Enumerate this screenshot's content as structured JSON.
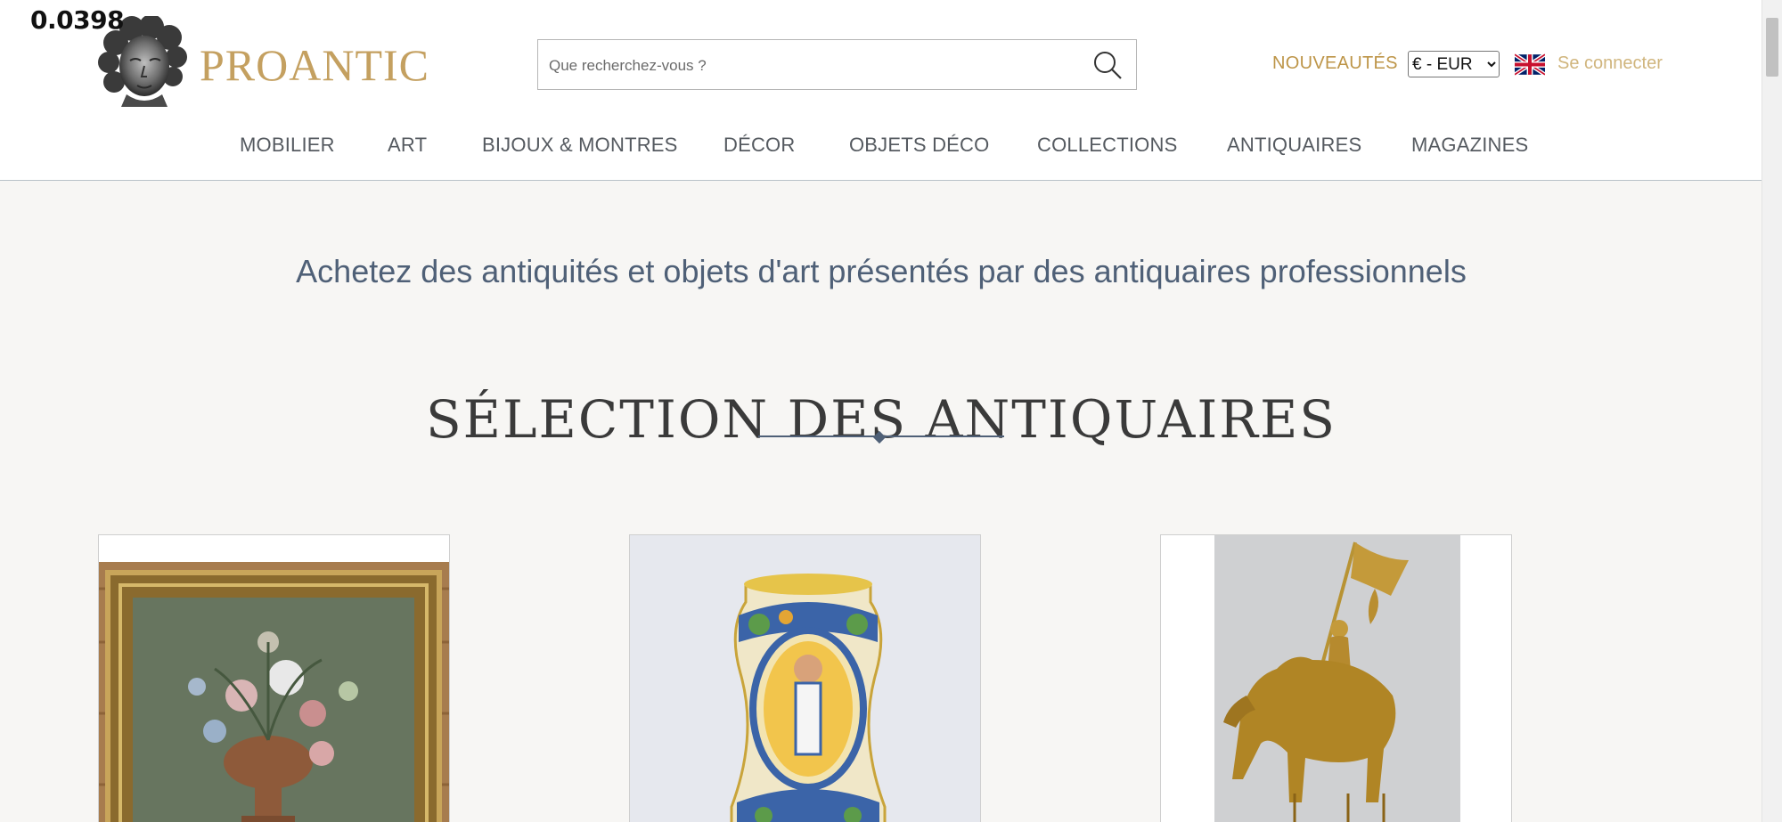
{
  "overlay": {
    "value": "0.0398"
  },
  "brand": {
    "name": "PROANTIC",
    "color": "#c4a060"
  },
  "search": {
    "placeholder": "Que recherchez-vous ?",
    "icon": "search-icon"
  },
  "header": {
    "nouveautes": "NOUVEAUTÉS",
    "currency": {
      "selected": "€ - EUR"
    },
    "language_flag": "uk-flag-icon",
    "login": "Se connecter"
  },
  "nav": {
    "items": [
      {
        "label": "MOBILIER"
      },
      {
        "label": "ART"
      },
      {
        "label": "BIJOUX & MONTRES"
      },
      {
        "label": "DÉCOR"
      },
      {
        "label": "OBJETS DÉCO"
      },
      {
        "label": "COLLECTIONS"
      },
      {
        "label": "ANTIQUAIRES"
      },
      {
        "label": "MAGAZINES"
      }
    ]
  },
  "main": {
    "tagline": "Achetez des antiquités et objets d'art présentés par des antiquaires professionnels",
    "section_title": "SÉLECTION DES ANTIQUAIRES"
  },
  "colors": {
    "accent": "#bd9548",
    "slate": "#4f6077",
    "background": "#f7f6f4"
  }
}
